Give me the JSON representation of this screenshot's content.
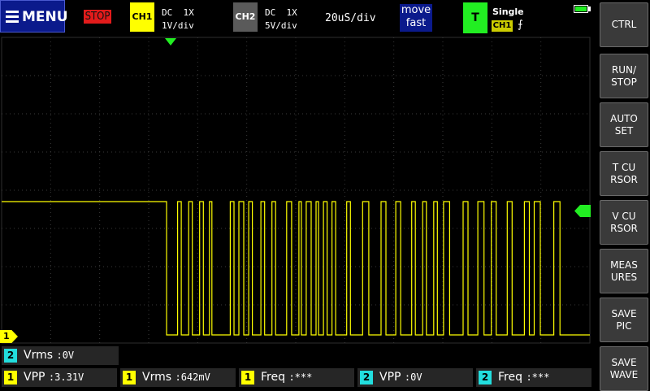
{
  "header": {
    "menu_label": "MENU",
    "run_state": "STOP",
    "ch1": {
      "label": "CH1",
      "coupling": "DC  1X",
      "scale": "1V/div",
      "color": "#ffff00"
    },
    "ch2": {
      "label": "CH2",
      "coupling": "DC  1X",
      "scale": "5V/div",
      "color": "#5a5a5a"
    },
    "timebase": "20uS/div",
    "move_mode": {
      "line1": "move",
      "line2": "fast"
    },
    "trigger": {
      "badge": "T",
      "mode": "Single",
      "source": "CH1",
      "edge": "⨍",
      "color": "#22ee22"
    },
    "battery_icon": "battery-full-icon"
  },
  "side_buttons": [
    {
      "label": "CTRL"
    },
    {
      "label": "RUN/\nSTOP"
    },
    {
      "label": "AUTO\nSET"
    },
    {
      "label": "T CU\nRSOR"
    },
    {
      "label": "V CU\nRSOR"
    },
    {
      "label": "MEAS\nURES"
    },
    {
      "label": "SAVE\nPIC"
    },
    {
      "label": "SAVE\nWAVE"
    }
  ],
  "markers": {
    "ground_ch1": "1"
  },
  "measurements": {
    "top": {
      "channel": "2",
      "name": "Vrms",
      "value": ":0V"
    },
    "bottom": [
      {
        "channel": "1",
        "name": "VPP",
        "value": ":3.31V"
      },
      {
        "channel": "1",
        "name": "Vrms",
        "value": ":642mV"
      },
      {
        "channel": "1",
        "name": "Freq",
        "value": ":***"
      },
      {
        "channel": "2",
        "name": "VPP",
        "value": ":0V"
      },
      {
        "channel": "2",
        "name": "Freq",
        "value": ":***"
      }
    ]
  },
  "waveform": {
    "channel": "CH1",
    "color": "#ffff00",
    "idle_level": "high",
    "transitions_us": [
      0,
      4.5,
      6,
      9,
      10.5,
      13.5,
      15,
      17.5,
      18.5,
      26,
      27.5,
      29.5,
      31.5,
      33.5,
      35,
      38.5,
      40,
      43,
      44.5,
      49,
      51,
      54,
      55,
      57,
      59,
      61,
      62,
      64,
      65.5,
      67.5,
      69,
      73.5,
      75,
      80,
      82.5,
      87.5,
      89.5,
      93.5,
      95.5,
      100,
      101.5,
      104.5,
      106,
      109,
      110.5,
      113,
      115.5,
      121,
      123,
      127,
      129.5,
      132.5,
      134.5,
      139,
      141,
      146,
      148,
      150,
      152.5,
      158,
      160.5
    ]
  }
}
